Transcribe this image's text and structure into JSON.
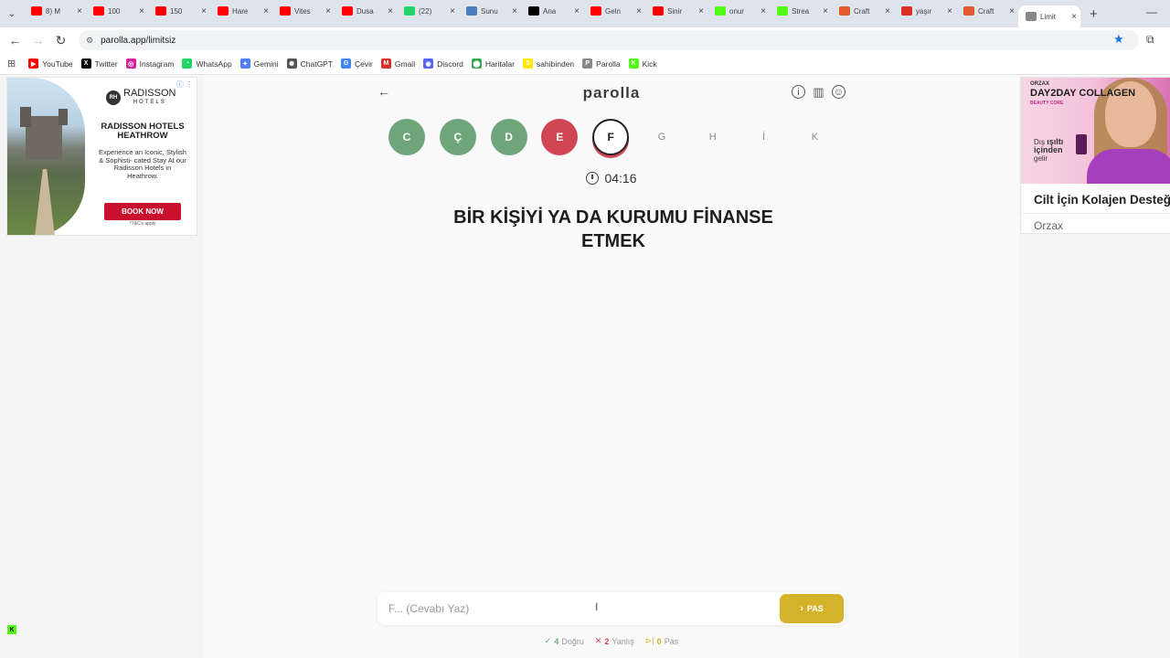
{
  "browser": {
    "tabs": [
      {
        "title": "8) M",
        "fav": "yt",
        "color": "#ff0000"
      },
      {
        "title": "100 ",
        "fav": "yt",
        "color": "#ff0000"
      },
      {
        "title": "150 ",
        "fav": "yt",
        "color": "#ff0000"
      },
      {
        "title": "Hare",
        "fav": "yt",
        "color": "#ff0000"
      },
      {
        "title": "Vites",
        "fav": "yt",
        "color": "#ff0000"
      },
      {
        "title": "Dusa",
        "fav": "yt",
        "color": "#ff0000"
      },
      {
        "title": "(22) ",
        "fav": "wa",
        "color": "#25d366"
      },
      {
        "title": "Sunu",
        "fav": "doc",
        "color": "#4a7fc1"
      },
      {
        "title": "Ana ",
        "fav": "x",
        "color": "#000000"
      },
      {
        "title": "Geln",
        "fav": "yt",
        "color": "#ff0000"
      },
      {
        "title": "Sinir",
        "fav": "yt",
        "color": "#ff0000"
      },
      {
        "title": "onur",
        "fav": "kick",
        "color": "#53fc18"
      },
      {
        "title": "Strea",
        "fav": "kick",
        "color": "#53fc18"
      },
      {
        "title": "Craft",
        "fav": "c",
        "color": "#e05a2b"
      },
      {
        "title": "yaşır",
        "fav": "gmail",
        "color": "#d93025"
      },
      {
        "title": "Craft",
        "fav": "c",
        "color": "#e05a2b"
      },
      {
        "title": "Limit",
        "fav": "parolla",
        "color": "#888888",
        "active": true
      }
    ],
    "url": "parolla.app/limitsiz",
    "bookmarks": [
      {
        "label": "YouTube",
        "color": "#ff0000",
        "glyph": "▶"
      },
      {
        "label": "Twitter",
        "color": "#000000",
        "glyph": "X"
      },
      {
        "label": "Instagram",
        "color": "#d6249f",
        "glyph": "◎"
      },
      {
        "label": "WhatsApp",
        "color": "#25d366",
        "glyph": "◔"
      },
      {
        "label": "Gemini",
        "color": "#4f7cf7",
        "glyph": "✦"
      },
      {
        "label": "ChatGPT",
        "color": "#555555",
        "glyph": "✺"
      },
      {
        "label": "Çevir",
        "color": "#4285f4",
        "glyph": "G"
      },
      {
        "label": "Gmail",
        "color": "#d93025",
        "glyph": "M"
      },
      {
        "label": "Discord",
        "color": "#5865f2",
        "glyph": "◉"
      },
      {
        "label": "Haritalar",
        "color": "#34a853",
        "glyph": "⬤"
      },
      {
        "label": "sahibinden",
        "color": "#ffe800",
        "glyph": "S"
      },
      {
        "label": "Parolla",
        "color": "#888888",
        "glyph": "P"
      },
      {
        "label": "Kick",
        "color": "#53fc18",
        "glyph": "K"
      }
    ]
  },
  "ads": {
    "left": {
      "brand": "RADISSON",
      "brand_sub": "HOTELS",
      "logo_mark": "RH",
      "headline": "RADISSON HOTELS HEATHROW",
      "body": "Experience an Iconic, Stylish & Sophisti- cated Stay At our Radisson Hotels in Heathrow.",
      "cta": "BOOK NOW",
      "terms": "*T&C's apply"
    },
    "right": {
      "brand_small": "ORZAX",
      "brand_big": "DAY2DAY COLLAGEN",
      "brand_tag": "BEAUTY CORE",
      "tagline_1": "Dış",
      "tagline_2": "ışıltı",
      "tagline_3": "içinden",
      "tagline_4": "gelir",
      "title": "Cilt İçin Kolajen Desteği",
      "advertiser": "Orzax"
    }
  },
  "game": {
    "brand": "parolla",
    "letters": [
      {
        "letter": "C",
        "state": "ok",
        "color": "#6fa57b"
      },
      {
        "letter": "Ç",
        "state": "ok",
        "color": "#6fa57b"
      },
      {
        "letter": "D",
        "state": "ok",
        "color": "#6fa57b"
      },
      {
        "letter": "E",
        "state": "bad",
        "color": "#d04655"
      },
      {
        "letter": "F",
        "state": "current"
      },
      {
        "letter": "G",
        "state": "pending"
      },
      {
        "letter": "H",
        "state": "pending"
      },
      {
        "letter": "İ",
        "state": "pending"
      },
      {
        "letter": "K",
        "state": "pending"
      }
    ],
    "timer": "04:16",
    "question": "BİR KİŞİYİ YA DA KURUMU FİNANSE ETMEK",
    "answer_placeholder": "F... (Cevabı Yaz)",
    "answer_value": "",
    "pass_label": "PAS",
    "stats": {
      "correct_count": "4",
      "correct_label": "Doğru",
      "wrong_count": "2",
      "wrong_label": "Yanlış",
      "pass_count": "0",
      "pass_label": "Pas"
    }
  }
}
